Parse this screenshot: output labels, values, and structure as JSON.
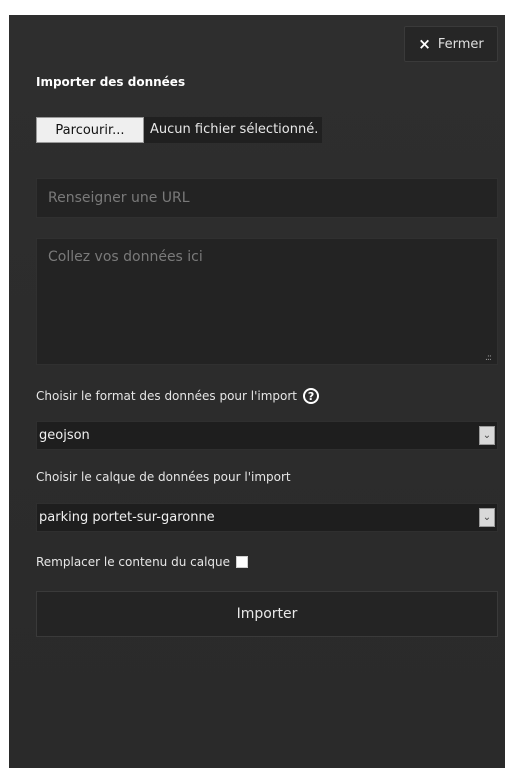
{
  "close": {
    "icon": "close-icon",
    "icon_glyph": "×",
    "label": "Fermer"
  },
  "title": "Importer des données",
  "file": {
    "browse_label": "Parcourir...",
    "status": "Aucun fichier sélectionné."
  },
  "url": {
    "placeholder": "Renseigner une URL",
    "value": ""
  },
  "paste": {
    "placeholder": "Collez vos données ici",
    "value": ""
  },
  "format": {
    "label": "Choisir le format des données pour l'import",
    "help_icon": "help-icon",
    "help_glyph": "?",
    "selected": "geojson"
  },
  "layer": {
    "label": "Choisir le calque de données pour l'import",
    "selected": "parking portet-sur-garonne"
  },
  "replace": {
    "label": "Remplacer le contenu du calque",
    "checked": false
  },
  "import_button": "Importer"
}
